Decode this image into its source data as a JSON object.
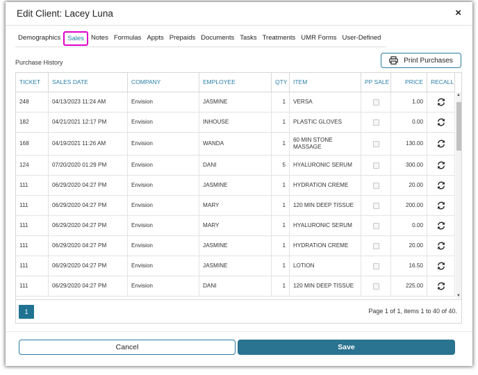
{
  "dialog": {
    "title": "Edit Client: Lacey Luna",
    "close": "×"
  },
  "tabs": [
    "Demographics",
    "Sales",
    "Notes",
    "Formulas",
    "Appts",
    "Prepaids",
    "Documents",
    "Tasks",
    "Treatments",
    "UMR Forms",
    "User-Defined"
  ],
  "active_tab": "Sales",
  "section_label": "Purchase History",
  "print_button": "Print Purchases",
  "columns": [
    "TICKET",
    "SALES DATE",
    "COMPANY",
    "EMPLOYEE",
    "QTY",
    "ITEM",
    "PP SALE",
    "PRICE",
    "RECALL"
  ],
  "rows": [
    {
      "ticket": "248",
      "date": "04/13/2023 11:24 AM",
      "company": "Envision",
      "employee": "JASMINE",
      "qty": "1",
      "item": "VERSA",
      "price": "1.00"
    },
    {
      "ticket": "182",
      "date": "04/21/2021 12:17 PM",
      "company": "Envision",
      "employee": "INHOUSE",
      "qty": "1",
      "item": "PLASTIC GLOVES",
      "price": "0.00"
    },
    {
      "ticket": "168",
      "date": "04/19/2021 11:26 AM",
      "company": "Envision",
      "employee": "WANDA",
      "qty": "1",
      "item": "60 MIN STONE MASSAGE",
      "price": "130.00"
    },
    {
      "ticket": "124",
      "date": "07/20/2020 01:29 PM",
      "company": "Envision",
      "employee": "DANI",
      "qty": "5",
      "item": "HYALURONIC SERUM",
      "price": "300.00"
    },
    {
      "ticket": "111",
      "date": "06/29/2020 04:27 PM",
      "company": "Envision",
      "employee": "JASMINE",
      "qty": "1",
      "item": "HYDRATION CREME",
      "price": "20.00"
    },
    {
      "ticket": "111",
      "date": "06/29/2020 04:27 PM",
      "company": "Envision",
      "employee": "MARY",
      "qty": "1",
      "item": "120 MIN DEEP TISSUE",
      "price": "200.00"
    },
    {
      "ticket": "111",
      "date": "06/29/2020 04:27 PM",
      "company": "Envision",
      "employee": "MARY",
      "qty": "1",
      "item": "HYALURONIC SERUM",
      "price": "0.00"
    },
    {
      "ticket": "111",
      "date": "06/29/2020 04:27 PM",
      "company": "Envision",
      "employee": "JASMINE",
      "qty": "1",
      "item": "HYDRATION CREME",
      "price": "20.00"
    },
    {
      "ticket": "111",
      "date": "06/29/2020 04:27 PM",
      "company": "Envision",
      "employee": "JASMINE",
      "qty": "1",
      "item": "LOTION",
      "price": "16.50"
    },
    {
      "ticket": "111",
      "date": "06/29/2020 04:27 PM",
      "company": "Envision",
      "employee": "DANI",
      "qty": "1",
      "item": "120 MIN DEEP TISSUE",
      "price": "225.00"
    }
  ],
  "pager": {
    "current_page": "1",
    "info": "Page 1 of 1, items 1 to 40 of 40."
  },
  "footer": {
    "cancel": "Cancel",
    "save": "Save"
  },
  "colors": {
    "accent": "#2a7391",
    "header_text": "#2a7fa8",
    "active_tab_outline": "#e000c8"
  }
}
